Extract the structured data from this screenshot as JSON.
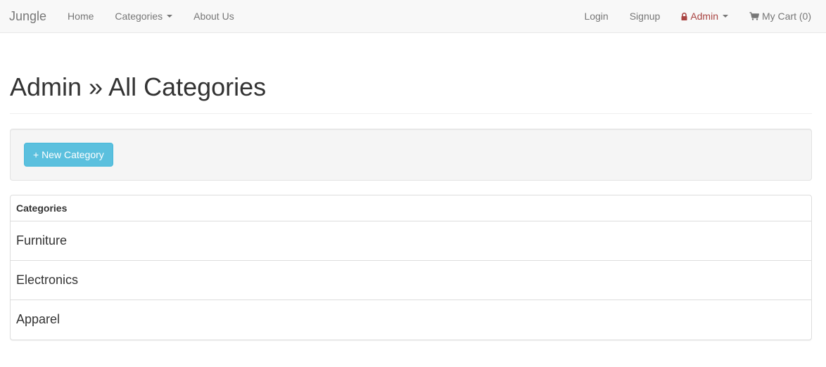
{
  "navbar": {
    "brand": "Jungle",
    "left_links": [
      {
        "label": "Home"
      },
      {
        "label": "Categories"
      },
      {
        "label": "About Us"
      }
    ],
    "right_links": [
      {
        "label": "Login"
      },
      {
        "label": "Signup"
      },
      {
        "label": "Admin",
        "icon": "lock-icon",
        "color": "#a94442"
      },
      {
        "label": "My Cart (0)",
        "icon": "shopping-cart-icon"
      }
    ]
  },
  "page": {
    "title": "Admin » All Categories"
  },
  "toolbar": {
    "new_category_label": "+ New Category",
    "button_color": "#5bc0de"
  },
  "categories_table": {
    "heading": "Categories",
    "rows": [
      {
        "name": "Furniture"
      },
      {
        "name": "Electronics"
      },
      {
        "name": "Apparel"
      }
    ]
  }
}
